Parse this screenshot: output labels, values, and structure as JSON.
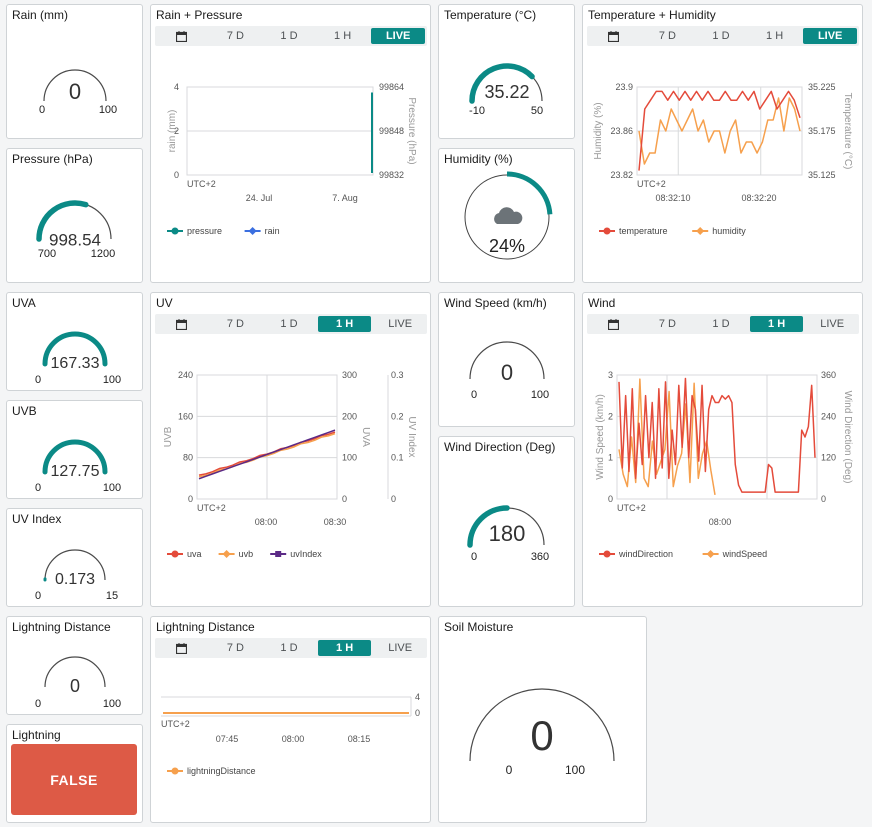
{
  "colors": {
    "teal": "#0b8a86",
    "red": "#e44b3b",
    "orange": "#f6a04d",
    "blue": "#3b6fe0",
    "purple": "#5b2a86",
    "grid": "#d8dadc",
    "false_bg": "#dd5a46"
  },
  "segment_labels": {
    "d7": "7 D",
    "d1": "1 D",
    "h1": "1 H",
    "live": "LIVE"
  },
  "widgets": {
    "rain": {
      "title": "Rain (mm)",
      "value": "0",
      "min": "0",
      "max": "100",
      "fraction": 0
    },
    "pressure": {
      "title": "Pressure (hPa)",
      "value": "998.54",
      "min": "700",
      "max": "1200",
      "fraction": 0.597
    },
    "uva": {
      "title": "UVA",
      "value": "167.33",
      "min": "0",
      "max": "100",
      "fraction": 1
    },
    "uvb": {
      "title": "UVB",
      "value": "127.75",
      "min": "0",
      "max": "100",
      "fraction": 1
    },
    "uvindex": {
      "title": "UV Index",
      "value": "0.173",
      "min": "0",
      "max": "15",
      "fraction": 0.012
    },
    "lightning_dist": {
      "title": "Lightning Distance",
      "value": "0",
      "min": "0",
      "max": "100",
      "fraction": 0
    },
    "lightning": {
      "title": "Lightning",
      "value": "FALSE"
    },
    "temperature": {
      "title": "Temperature (°C)",
      "value": "35.22",
      "min": "-10",
      "max": "50",
      "fraction": 0.754
    },
    "humidity": {
      "title": "Humidity (%)",
      "value": "24%",
      "fraction": 0.24,
      "icon": "cloud-icon"
    },
    "wind_speed": {
      "title": "Wind Speed (km/h)",
      "value": "0",
      "min": "0",
      "max": "100",
      "fraction": 0
    },
    "wind_dir": {
      "title": "Wind Direction (Deg)",
      "value": "180",
      "min": "0",
      "max": "360",
      "fraction": 0.5
    },
    "soil": {
      "title": "Soil Moisture",
      "value": "0",
      "min": "0",
      "max": "100",
      "fraction": 0
    }
  },
  "charts": {
    "rain_pressure": {
      "title": "Rain + Pressure",
      "active": "live",
      "left_label": "rain (mm)",
      "right_label": "Pressure (hPa)",
      "left_ticks": [
        "4",
        "2",
        "0"
      ],
      "right_ticks": [
        "99864",
        "99848",
        "99832"
      ],
      "tz": "UTC+2",
      "x_ticks": [
        "24. Jul",
        "7. Aug"
      ],
      "legend": [
        "pressure",
        "rain"
      ]
    },
    "temp_hum": {
      "title": "Temperature + Humidity",
      "active": "live",
      "left_label": "Humidity (%)",
      "right_label": "Temperature (°C)",
      "left_ticks": [
        "23.9",
        "23.86",
        "23.82"
      ],
      "right_ticks": [
        "35.225",
        "35.175",
        "35.125"
      ],
      "tz": "UTC+2",
      "x_ticks": [
        "08:32:10",
        "08:32:20"
      ],
      "legend": [
        "temperature",
        "humidity"
      ]
    },
    "uv": {
      "title": "UV",
      "active": "h1",
      "left_label": "UVB",
      "mid_label": "UVA",
      "right_label": "UV Index",
      "left_ticks": [
        "240",
        "160",
        "80",
        "0"
      ],
      "mid_ticks": [
        "300",
        "200",
        "100",
        "0"
      ],
      "right_ticks": [
        "0.3",
        "0.2",
        "0.1",
        "0"
      ],
      "tz": "UTC+2",
      "x_ticks": [
        "08:00",
        "08:30"
      ],
      "legend": [
        "uva",
        "uvb",
        "uvIndex"
      ]
    },
    "wind": {
      "title": "Wind",
      "active": "h1",
      "left_label": "Wind Speed (km/h)",
      "right_label": "Wind Direction (Deg)",
      "left_ticks": [
        "3",
        "2",
        "1",
        "0"
      ],
      "right_ticks": [
        "360",
        "240",
        "120",
        "0"
      ],
      "tz": "UTC+2",
      "x_ticks": [
        "08:00"
      ],
      "legend": [
        "windDirection",
        "windSpeed"
      ]
    },
    "lightning": {
      "title": "Lightning Distance",
      "active": "h1",
      "right_ticks": [
        "4",
        "0"
      ],
      "tz": "UTC+2",
      "x_ticks": [
        "07:45",
        "08:00",
        "08:15"
      ],
      "legend": [
        "lightningDistance"
      ]
    }
  },
  "chart_data": [
    {
      "type": "line",
      "title": "Rain + Pressure",
      "series": [
        {
          "name": "pressure",
          "x": [
            "7. Aug"
          ],
          "y": [
            99848
          ]
        },
        {
          "name": "rain",
          "values": []
        }
      ],
      "ylim_left": [
        0,
        4
      ],
      "ylim_right": [
        99832,
        99864
      ]
    },
    {
      "type": "line",
      "title": "Temperature + Humidity",
      "series": [
        {
          "name": "temperature",
          "values": [
            35.13,
            35.2,
            35.21,
            35.22,
            35.22,
            35.21,
            35.22,
            35.21,
            35.22,
            35.21,
            35.22,
            35.21,
            35.22,
            35.21,
            35.21,
            35.22,
            35.21,
            35.21,
            35.22,
            35.21,
            35.22,
            35.2,
            35.21,
            35.22,
            35.2,
            35.21,
            35.22,
            35.21,
            35.19
          ]
        },
        {
          "name": "humidity",
          "values": [
            23.86,
            23.83,
            23.84,
            23.84,
            23.87,
            23.86,
            23.88,
            23.87,
            23.86,
            23.87,
            23.88,
            23.86,
            23.87,
            23.85,
            23.86,
            23.86,
            23.84,
            23.86,
            23.87,
            23.84,
            23.85,
            23.85,
            23.84,
            23.85,
            23.87,
            23.87,
            23.89,
            23.86,
            23.89,
            23.88,
            23.86
          ]
        }
      ],
      "ylim_left": [
        23.82,
        23.9
      ],
      "ylim_right": [
        35.125,
        35.225
      ]
    },
    {
      "type": "line",
      "title": "UV",
      "series": [
        {
          "name": "uva",
          "start": 45,
          "end": 130
        },
        {
          "name": "uvb",
          "start": 42,
          "end": 127
        },
        {
          "name": "uvIndex",
          "start": 0.05,
          "end": 0.17
        }
      ],
      "ylim_left": [
        0,
        240
      ],
      "ylim_mid": [
        0,
        300
      ],
      "ylim_right": [
        0,
        0.3
      ]
    },
    {
      "type": "line",
      "title": "Wind",
      "series": [
        {
          "name": "windDirection",
          "values": [
            340,
            90,
            300,
            80,
            320,
            60,
            220,
            100,
            300,
            120,
            280,
            60,
            320,
            90,
            340,
            60,
            200,
            100,
            330,
            150,
            350,
            120,
            300,
            260,
            110,
            330,
            80,
            260,
            300,
            280,
            280,
            300,
            290,
            300,
            280,
            100,
            40,
            20,
            20,
            20,
            20,
            20,
            20,
            20,
            20,
            100,
            90,
            20,
            20,
            20,
            20,
            20,
            20,
            20,
            20,
            200,
            180,
            210,
            330,
            120
          ]
        },
        {
          "name": "windSpeed",
          "values": [
            1.2,
            0.6,
            0.3,
            1.5,
            0.4,
            2.9,
            0.5,
            0.3,
            1.4,
            0.6,
            0.9,
            1.2,
            2.6,
            0.3,
            0.8,
            1.1,
            2.3,
            0.4,
            2.8,
            0.5,
            1.1,
            1.4,
            0.7,
            0.1
          ]
        }
      ],
      "ylim_left": [
        0,
        3
      ],
      "ylim_right": [
        0,
        360
      ]
    },
    {
      "type": "line",
      "title": "Lightning Distance",
      "series": [
        {
          "name": "lightningDistance",
          "values": [
            0,
            0,
            0,
            0,
            0,
            0,
            0,
            0,
            0,
            0
          ]
        }
      ],
      "ylim_right": [
        0,
        4
      ]
    }
  ]
}
